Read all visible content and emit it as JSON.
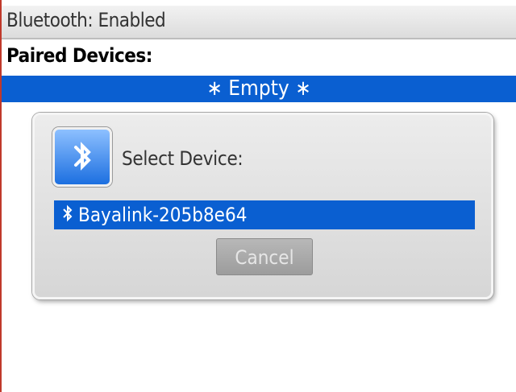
{
  "header": {
    "title": "Bluetooth: Enabled"
  },
  "paired": {
    "label": "Paired Devices:",
    "empty_text": "∗ Empty ∗"
  },
  "dialog": {
    "title": "Select Device:",
    "icon": "bluetooth-icon",
    "devices": [
      {
        "name": "Bayalink-205b8e64",
        "icon": "bluetooth-icon",
        "selected": true
      }
    ],
    "cancel_label": "Cancel"
  },
  "colors": {
    "selection": "#0a5fd1",
    "dialog_bg": "#e0e0e0",
    "button_disabled": "#a8a8a8"
  }
}
